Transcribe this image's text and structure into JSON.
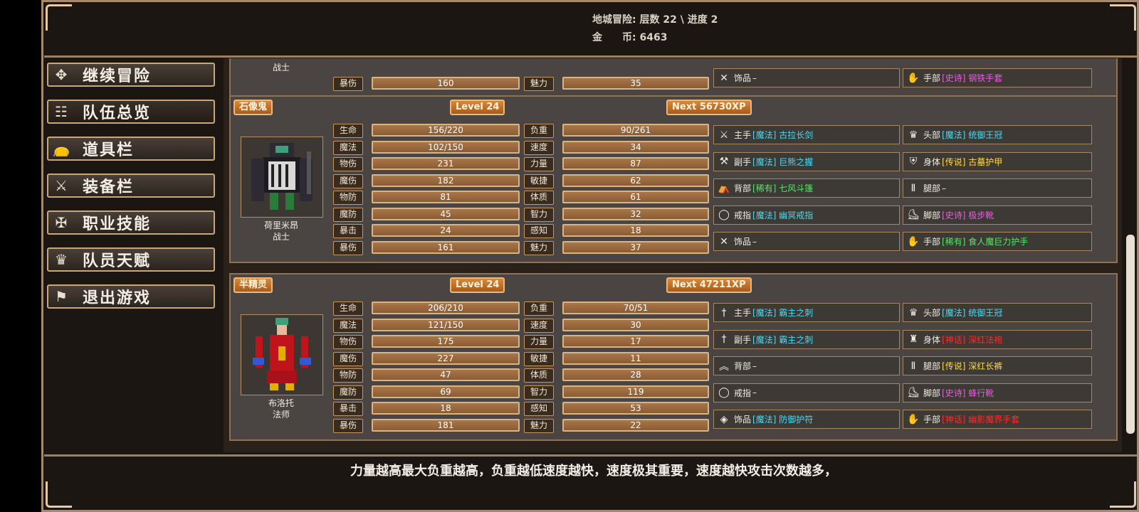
{
  "header": {
    "line1": "地城冒险: 层数 22 \\ 进度 2",
    "line2": "金　　币: 6463"
  },
  "menu": [
    {
      "label": "继续冒险",
      "icon": "dragon-icon"
    },
    {
      "label": "队伍总览",
      "icon": "party-icon"
    },
    {
      "label": "道具栏",
      "icon": "bag-icon"
    },
    {
      "label": "装备栏",
      "icon": "sword-shield-icon"
    },
    {
      "label": "职业技能",
      "icon": "winged-sword-icon"
    },
    {
      "label": "队员天赋",
      "icon": "crown-icon"
    },
    {
      "label": "退出游戏",
      "icon": "flag-icon"
    }
  ],
  "partial_card": {
    "name_class": "战士",
    "stats": [
      {
        "label": "暴伤",
        "value": "160",
        "label2": "魅力",
        "value2": "35"
      }
    ],
    "equip": [
      {
        "slot": "饰品",
        "item": "–",
        "quality": "",
        "icon": "crossed-tools-icon"
      },
      {
        "slot": "手部",
        "item": "[史诗] 钢铁手套",
        "quality": "epic",
        "icon": "gauntlet-icon"
      }
    ]
  },
  "characters": [
    {
      "race": "石像鬼",
      "level": "Level 24",
      "next": "Next 56730XP",
      "name": "荷里米昂",
      "class": "战士",
      "stats": [
        {
          "label": "生命",
          "value": "156/220",
          "label2": "负重",
          "value2": "90/261"
        },
        {
          "label": "魔法",
          "value": "102/150",
          "label2": "速度",
          "value2": "34"
        },
        {
          "label": "物伤",
          "value": "231",
          "label2": "力量",
          "value2": "87"
        },
        {
          "label": "魔伤",
          "value": "182",
          "label2": "敏捷",
          "value2": "62"
        },
        {
          "label": "物防",
          "value": "81",
          "label2": "体质",
          "value2": "61"
        },
        {
          "label": "魔防",
          "value": "45",
          "label2": "智力",
          "value2": "32"
        },
        {
          "label": "暴击",
          "value": "24",
          "label2": "感知",
          "value2": "18"
        },
        {
          "label": "暴伤",
          "value": "161",
          "label2": "魅力",
          "value2": "37"
        }
      ],
      "equip": [
        {
          "slot": "主手",
          "item": "[魔法] 古拉长剑",
          "quality": "magic",
          "icon": "sword-icon"
        },
        {
          "slot": "头部",
          "item": "[魔法] 统御王冠",
          "quality": "magic",
          "icon": "crown-icon"
        },
        {
          "slot": "副手",
          "item": "[魔法] 巨熊之握",
          "quality": "magic",
          "icon": "club-icon"
        },
        {
          "slot": "身体",
          "item": "[传说] 古墓护甲",
          "quality": "legend",
          "icon": "armor-icon"
        },
        {
          "slot": "背部",
          "item": "[稀有] 七风斗篷",
          "quality": "rare",
          "icon": "cloak-icon"
        },
        {
          "slot": "腿部",
          "item": "–",
          "quality": "",
          "icon": "pants-icon"
        },
        {
          "slot": "戒指",
          "item": "[魔法] 幽冥戒指",
          "quality": "magic",
          "icon": "ring-icon"
        },
        {
          "slot": "脚部",
          "item": "[史诗] 极步靴",
          "quality": "epic",
          "icon": "boots-icon"
        },
        {
          "slot": "饰品",
          "item": "–",
          "quality": "",
          "icon": "crossed-tools-icon"
        },
        {
          "slot": "手部",
          "item": "[稀有] 食人魔巨力护手",
          "quality": "rare",
          "icon": "gauntlet-icon"
        }
      ]
    },
    {
      "race": "半精灵",
      "level": "Level 24",
      "next": "Next 47211XP",
      "name": "布洛托",
      "class": "法师",
      "stats": [
        {
          "label": "生命",
          "value": "206/210",
          "label2": "负重",
          "value2": "70/51"
        },
        {
          "label": "魔法",
          "value": "121/150",
          "label2": "速度",
          "value2": "30"
        },
        {
          "label": "物伤",
          "value": "175",
          "label2": "力量",
          "value2": "17"
        },
        {
          "label": "魔伤",
          "value": "227",
          "label2": "敏捷",
          "value2": "11"
        },
        {
          "label": "物防",
          "value": "47",
          "label2": "体质",
          "value2": "28"
        },
        {
          "label": "魔防",
          "value": "69",
          "label2": "智力",
          "value2": "119"
        },
        {
          "label": "暴击",
          "value": "18",
          "label2": "感知",
          "value2": "53"
        },
        {
          "label": "暴伤",
          "value": "181",
          "label2": "魅力",
          "value2": "22"
        }
      ],
      "equip": [
        {
          "slot": "主手",
          "item": "[魔法] 霸主之刺",
          "quality": "magic",
          "icon": "dagger-icon"
        },
        {
          "slot": "头部",
          "item": "[魔法] 统御王冠",
          "quality": "magic",
          "icon": "crown-icon"
        },
        {
          "slot": "副手",
          "item": "[魔法] 霸主之刺",
          "quality": "magic",
          "icon": "dagger-icon"
        },
        {
          "slot": "身体",
          "item": "[神话] 深红法袍",
          "quality": "myth",
          "icon": "robe-icon"
        },
        {
          "slot": "背部",
          "item": "–",
          "quality": "",
          "icon": "wings-icon"
        },
        {
          "slot": "腿部",
          "item": "[传说] 深红长裤",
          "quality": "legend",
          "icon": "pants-icon"
        },
        {
          "slot": "戒指",
          "item": "–",
          "quality": "",
          "icon": "ring-icon"
        },
        {
          "slot": "脚部",
          "item": "[史诗] 蜂行靴",
          "quality": "epic",
          "icon": "boots-icon"
        },
        {
          "slot": "饰品",
          "item": "[魔法] 防御护符",
          "quality": "magic",
          "icon": "amulet-icon"
        },
        {
          "slot": "手部",
          "item": "[神话] 幽影魔界手套",
          "quality": "myth",
          "icon": "gauntlet-icon"
        }
      ]
    }
  ],
  "footer": {
    "tip": "力量越高最大负重越高，负重越低速度越快，速度极其重要，速度越快攻击次数越多，"
  }
}
